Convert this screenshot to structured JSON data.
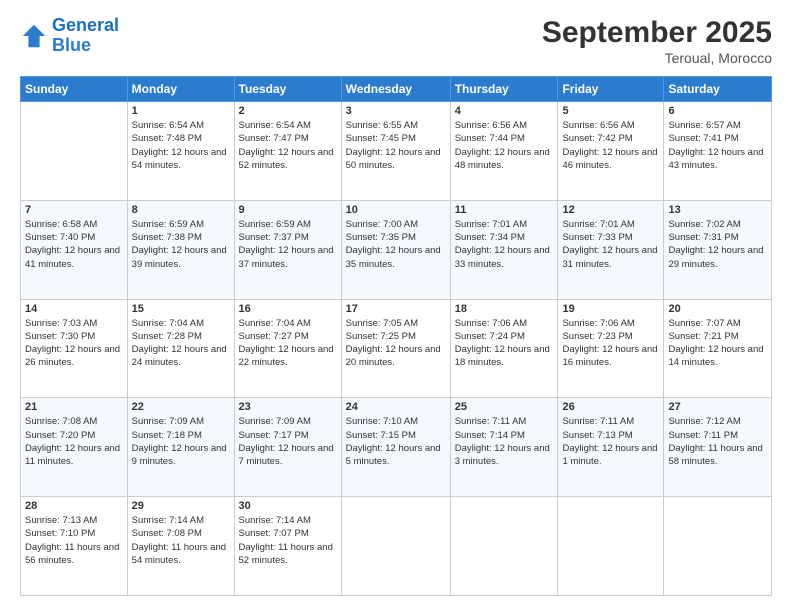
{
  "header": {
    "logo_line1": "General",
    "logo_line2": "Blue",
    "month": "September 2025",
    "location": "Teroual, Morocco"
  },
  "weekdays": [
    "Sunday",
    "Monday",
    "Tuesday",
    "Wednesday",
    "Thursday",
    "Friday",
    "Saturday"
  ],
  "weeks": [
    [
      {
        "day": "",
        "sunrise": "",
        "sunset": "",
        "daylight": ""
      },
      {
        "day": "1",
        "sunrise": "Sunrise: 6:54 AM",
        "sunset": "Sunset: 7:48 PM",
        "daylight": "Daylight: 12 hours and 54 minutes."
      },
      {
        "day": "2",
        "sunrise": "Sunrise: 6:54 AM",
        "sunset": "Sunset: 7:47 PM",
        "daylight": "Daylight: 12 hours and 52 minutes."
      },
      {
        "day": "3",
        "sunrise": "Sunrise: 6:55 AM",
        "sunset": "Sunset: 7:45 PM",
        "daylight": "Daylight: 12 hours and 50 minutes."
      },
      {
        "day": "4",
        "sunrise": "Sunrise: 6:56 AM",
        "sunset": "Sunset: 7:44 PM",
        "daylight": "Daylight: 12 hours and 48 minutes."
      },
      {
        "day": "5",
        "sunrise": "Sunrise: 6:56 AM",
        "sunset": "Sunset: 7:42 PM",
        "daylight": "Daylight: 12 hours and 46 minutes."
      },
      {
        "day": "6",
        "sunrise": "Sunrise: 6:57 AM",
        "sunset": "Sunset: 7:41 PM",
        "daylight": "Daylight: 12 hours and 43 minutes."
      }
    ],
    [
      {
        "day": "7",
        "sunrise": "Sunrise: 6:58 AM",
        "sunset": "Sunset: 7:40 PM",
        "daylight": "Daylight: 12 hours and 41 minutes."
      },
      {
        "day": "8",
        "sunrise": "Sunrise: 6:59 AM",
        "sunset": "Sunset: 7:38 PM",
        "daylight": "Daylight: 12 hours and 39 minutes."
      },
      {
        "day": "9",
        "sunrise": "Sunrise: 6:59 AM",
        "sunset": "Sunset: 7:37 PM",
        "daylight": "Daylight: 12 hours and 37 minutes."
      },
      {
        "day": "10",
        "sunrise": "Sunrise: 7:00 AM",
        "sunset": "Sunset: 7:35 PM",
        "daylight": "Daylight: 12 hours and 35 minutes."
      },
      {
        "day": "11",
        "sunrise": "Sunrise: 7:01 AM",
        "sunset": "Sunset: 7:34 PM",
        "daylight": "Daylight: 12 hours and 33 minutes."
      },
      {
        "day": "12",
        "sunrise": "Sunrise: 7:01 AM",
        "sunset": "Sunset: 7:33 PM",
        "daylight": "Daylight: 12 hours and 31 minutes."
      },
      {
        "day": "13",
        "sunrise": "Sunrise: 7:02 AM",
        "sunset": "Sunset: 7:31 PM",
        "daylight": "Daylight: 12 hours and 29 minutes."
      }
    ],
    [
      {
        "day": "14",
        "sunrise": "Sunrise: 7:03 AM",
        "sunset": "Sunset: 7:30 PM",
        "daylight": "Daylight: 12 hours and 26 minutes."
      },
      {
        "day": "15",
        "sunrise": "Sunrise: 7:04 AM",
        "sunset": "Sunset: 7:28 PM",
        "daylight": "Daylight: 12 hours and 24 minutes."
      },
      {
        "day": "16",
        "sunrise": "Sunrise: 7:04 AM",
        "sunset": "Sunset: 7:27 PM",
        "daylight": "Daylight: 12 hours and 22 minutes."
      },
      {
        "day": "17",
        "sunrise": "Sunrise: 7:05 AM",
        "sunset": "Sunset: 7:25 PM",
        "daylight": "Daylight: 12 hours and 20 minutes."
      },
      {
        "day": "18",
        "sunrise": "Sunrise: 7:06 AM",
        "sunset": "Sunset: 7:24 PM",
        "daylight": "Daylight: 12 hours and 18 minutes."
      },
      {
        "day": "19",
        "sunrise": "Sunrise: 7:06 AM",
        "sunset": "Sunset: 7:23 PM",
        "daylight": "Daylight: 12 hours and 16 minutes."
      },
      {
        "day": "20",
        "sunrise": "Sunrise: 7:07 AM",
        "sunset": "Sunset: 7:21 PM",
        "daylight": "Daylight: 12 hours and 14 minutes."
      }
    ],
    [
      {
        "day": "21",
        "sunrise": "Sunrise: 7:08 AM",
        "sunset": "Sunset: 7:20 PM",
        "daylight": "Daylight: 12 hours and 11 minutes."
      },
      {
        "day": "22",
        "sunrise": "Sunrise: 7:09 AM",
        "sunset": "Sunset: 7:18 PM",
        "daylight": "Daylight: 12 hours and 9 minutes."
      },
      {
        "day": "23",
        "sunrise": "Sunrise: 7:09 AM",
        "sunset": "Sunset: 7:17 PM",
        "daylight": "Daylight: 12 hours and 7 minutes."
      },
      {
        "day": "24",
        "sunrise": "Sunrise: 7:10 AM",
        "sunset": "Sunset: 7:15 PM",
        "daylight": "Daylight: 12 hours and 5 minutes."
      },
      {
        "day": "25",
        "sunrise": "Sunrise: 7:11 AM",
        "sunset": "Sunset: 7:14 PM",
        "daylight": "Daylight: 12 hours and 3 minutes."
      },
      {
        "day": "26",
        "sunrise": "Sunrise: 7:11 AM",
        "sunset": "Sunset: 7:13 PM",
        "daylight": "Daylight: 12 hours and 1 minute."
      },
      {
        "day": "27",
        "sunrise": "Sunrise: 7:12 AM",
        "sunset": "Sunset: 7:11 PM",
        "daylight": "Daylight: 11 hours and 58 minutes."
      }
    ],
    [
      {
        "day": "28",
        "sunrise": "Sunrise: 7:13 AM",
        "sunset": "Sunset: 7:10 PM",
        "daylight": "Daylight: 11 hours and 56 minutes."
      },
      {
        "day": "29",
        "sunrise": "Sunrise: 7:14 AM",
        "sunset": "Sunset: 7:08 PM",
        "daylight": "Daylight: 11 hours and 54 minutes."
      },
      {
        "day": "30",
        "sunrise": "Sunrise: 7:14 AM",
        "sunset": "Sunset: 7:07 PM",
        "daylight": "Daylight: 11 hours and 52 minutes."
      },
      {
        "day": "",
        "sunrise": "",
        "sunset": "",
        "daylight": ""
      },
      {
        "day": "",
        "sunrise": "",
        "sunset": "",
        "daylight": ""
      },
      {
        "day": "",
        "sunrise": "",
        "sunset": "",
        "daylight": ""
      },
      {
        "day": "",
        "sunrise": "",
        "sunset": "",
        "daylight": ""
      }
    ]
  ]
}
